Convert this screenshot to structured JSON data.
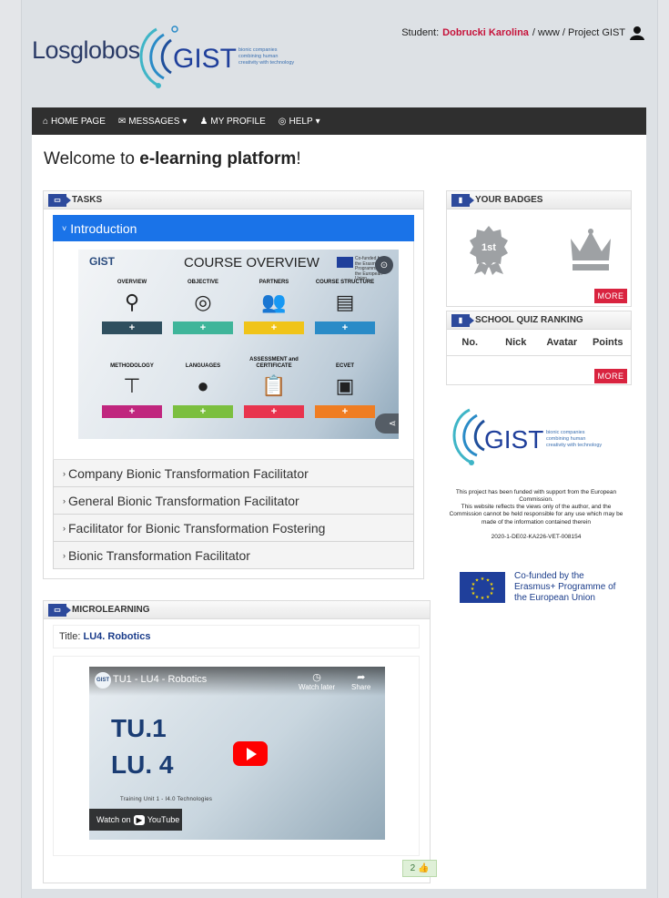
{
  "header": {
    "brand": "Losglobos",
    "logo_text": "GIST",
    "logo_tagline": "bionic companies combining human creativity with technology",
    "user_prefix": "Student:",
    "user_name": "Dobrucki Karolina",
    "user_path": "/ www / Project GIST"
  },
  "nav": {
    "home": "HOME PAGE",
    "messages": "MESSAGES",
    "profile": "MY PROFILE",
    "help": "HELP"
  },
  "main": {
    "welcome_prefix": "Welcome to ",
    "welcome_bold": "e-learning platform",
    "welcome_suffix": "!"
  },
  "tasks": {
    "title": "TASKS",
    "active": "Introduction",
    "items": [
      "Company Bionic Transformation Facilitator",
      "General Bionic Transformation Facilitator",
      "Facilitator for Bionic Transformation Fostering",
      "Bionic Transformation Facilitator"
    ],
    "course": {
      "title": "COURSE OVERVIEW",
      "logo": "GIST",
      "eu_text": "Co-funded by the Erasmus+ Programme of the European Union",
      "top_labels": [
        "OVERVIEW",
        "OBJECTIVE",
        "PARTNERS",
        "COURSE STRUCTURE"
      ],
      "bottom_labels": [
        "METHODOLOGY",
        "LANGUAGES",
        "ASSESSMENT and CERTIFICATE",
        "ECVET"
      ],
      "top_colors": [
        "#2f4f5f",
        "#3fb59a",
        "#f0c419",
        "#2a8bc7"
      ],
      "bottom_colors": [
        "#c0267e",
        "#7bbf3f",
        "#e8344e",
        "#ef7d22"
      ],
      "plus": "+"
    }
  },
  "micro": {
    "title": "MICROLEARNING",
    "label": "Title:",
    "lesson": "LU4. Robotics",
    "video_title": "TU1 - LU4 - Robotics",
    "watch_later": "Watch later",
    "share": "Share",
    "big1": "TU.1",
    "big2": "LU. 4",
    "watch_on": "Watch on",
    "youtube": "YouTube",
    "footer": "Training Unit 1 - I4.0 Technologies",
    "likes": "2"
  },
  "badges": {
    "title": "YOUR BADGES",
    "badge1": "1st",
    "more": "MORE"
  },
  "quiz": {
    "title": "SCHOOL QUIZ RANKING",
    "cols": [
      "No.",
      "Nick",
      "Avatar",
      "Points"
    ],
    "more": "MORE"
  },
  "sidebar": {
    "logo_text": "GIST",
    "tagline": "bionic companies combining human creativity with technology",
    "funded1": "This project has been funded with support from the European Commission.",
    "funded2": "This website reflects the views only of the author, and the Commission cannot be held responsible for any use which may be made of the information contained therein",
    "project_no": "2020-1-DE02-KA226-VET-008154",
    "erasmus": "Co-funded by the Erasmus+ Programme of the European Union"
  }
}
